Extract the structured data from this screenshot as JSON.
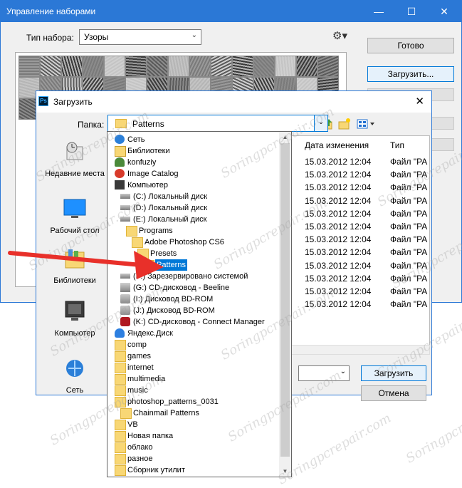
{
  "bg_window": {
    "title": "Управление наборами",
    "type_label": "Тип набора:",
    "type_value": "Узоры",
    "done_button": "Готово",
    "load_button": "Загрузить..."
  },
  "dialog": {
    "title": "Загрузить",
    "app_icon": "Ps",
    "folder_label": "Папка:",
    "folder_value": "Patterns",
    "places": [
      {
        "label": "Недавние места",
        "icon": "recent-places-icon"
      },
      {
        "label": "Рабочий стол",
        "icon": "desktop-icon"
      },
      {
        "label": "Библиотеки",
        "icon": "libraries-icon"
      },
      {
        "label": "Компьютер",
        "icon": "computer-icon"
      },
      {
        "label": "Сеть",
        "icon": "network-icon"
      }
    ],
    "columns": {
      "date": "Дата изменения",
      "type": "Тип"
    },
    "rows": [
      {
        "date": "15.03.2012 12:04",
        "type": "Файл \"PA"
      },
      {
        "date": "15.03.2012 12:04",
        "type": "Файл \"PA"
      },
      {
        "date": "15.03.2012 12:04",
        "type": "Файл \"PA"
      },
      {
        "date": "15.03.2012 12:04",
        "type": "Файл \"PA"
      },
      {
        "date": "15.03.2012 12:04",
        "type": "Файл \"PA"
      },
      {
        "date": "15.03.2012 12:04",
        "type": "Файл \"PA"
      },
      {
        "date": "15.03.2012 12:04",
        "type": "Файл \"PA"
      },
      {
        "date": "15.03.2012 12:04",
        "type": "Файл \"PA"
      },
      {
        "date": "15.03.2012 12:04",
        "type": "Файл \"PA"
      },
      {
        "date": "15.03.2012 12:04",
        "type": "Файл \"PA"
      },
      {
        "date": "15.03.2012 12:04",
        "type": "Файл \"PA"
      },
      {
        "date": "15.03.2012 12:04",
        "type": "Файл \"PA"
      }
    ],
    "load_button": "Загрузить",
    "cancel_button": "Отмена"
  },
  "dropdown": {
    "items": [
      {
        "label": "Сеть",
        "icon": "network-icon"
      },
      {
        "label": "Библиотеки",
        "icon": "libraries-icon"
      },
      {
        "label": "konfuziy",
        "icon": "user-icon"
      },
      {
        "label": "Image Catalog",
        "icon": "image-catalog-icon"
      },
      {
        "label": "Компьютер",
        "icon": "computer-icon"
      },
      {
        "label": "(C:) Локальный диск",
        "icon": "drive-icon"
      },
      {
        "label": "(D:) Локальный диск",
        "icon": "drive-icon"
      },
      {
        "label": "(E:) Локальный диск",
        "icon": "drive-icon"
      },
      {
        "label": "Programs",
        "icon": "folder-icon"
      },
      {
        "label": "Adobe Photoshop CS6",
        "icon": "folder-icon"
      },
      {
        "label": "Presets",
        "icon": "folder-icon"
      },
      {
        "label": "Patterns",
        "icon": "folder-icon",
        "selected": true
      },
      {
        "label": "(F:) Зарезервировано системой",
        "icon": "drive-icon"
      },
      {
        "label": "(G:) CD-дисковод - Beeline",
        "icon": "cd-drive-icon"
      },
      {
        "label": "(I:) Дисковод BD-ROM",
        "icon": "bd-drive-icon"
      },
      {
        "label": "(J:) Дисковод BD-ROM",
        "icon": "bd-drive-icon"
      },
      {
        "label": "(K:) CD-дисковод - Connect Manager",
        "icon": "connect-manager-icon"
      },
      {
        "label": "Яндекс.Диск",
        "icon": "yandex-disk-icon"
      },
      {
        "label": "comp",
        "icon": "folder-icon"
      },
      {
        "label": "games",
        "icon": "folder-icon"
      },
      {
        "label": "internet",
        "icon": "folder-icon"
      },
      {
        "label": "multimedia",
        "icon": "folder-icon"
      },
      {
        "label": "music",
        "icon": "folder-icon"
      },
      {
        "label": "photoshop_patterns_0031",
        "icon": "folder-icon"
      },
      {
        "label": "Chainmail Patterns",
        "icon": "folder-icon"
      },
      {
        "label": "VB",
        "icon": "folder-icon"
      },
      {
        "label": "Новая папка",
        "icon": "folder-icon"
      },
      {
        "label": "облако",
        "icon": "folder-icon"
      },
      {
        "label": "разное",
        "icon": "folder-icon"
      },
      {
        "label": "Сборник утилит",
        "icon": "folder-icon"
      }
    ]
  },
  "watermark": "Soringpcrepair.com"
}
